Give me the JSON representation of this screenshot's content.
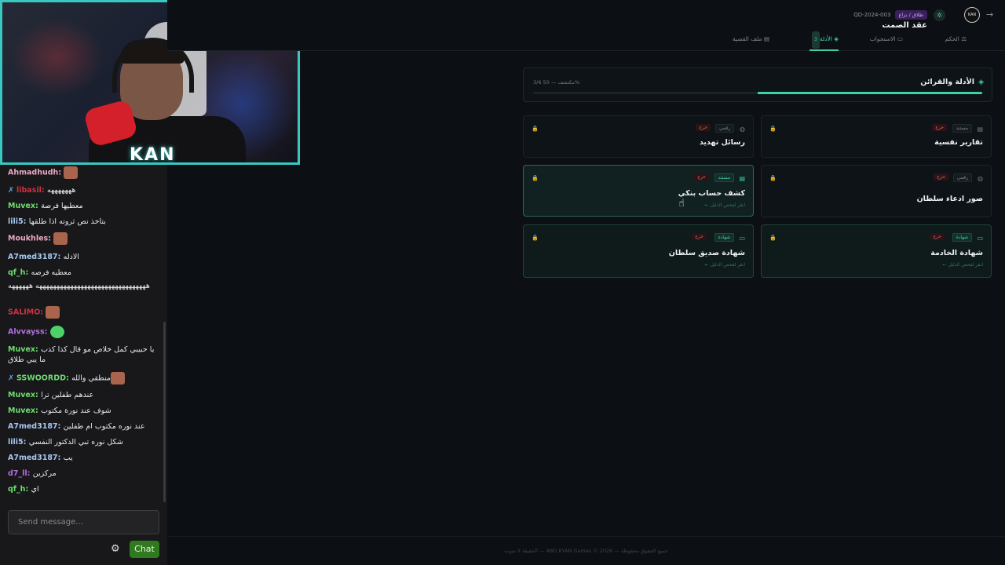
{
  "webcam": {
    "logo_text": "KAN"
  },
  "chat": {
    "messages": [
      {
        "user": "Ahmadhudh",
        "text": "",
        "emote": true,
        "color": "#e8a8c0"
      },
      {
        "user": "libasil",
        "text": "هههههههه",
        "prefix": "✗",
        "color": "#d03040"
      },
      {
        "user": "Muvex",
        "text": "معطيها فرصة",
        "color": "#6fdc6f"
      },
      {
        "user": "lili5",
        "text": "بتاخذ نص ثروته اذا طلقها",
        "color": "#a8c8f0"
      },
      {
        "user": "Moukhles",
        "text": "",
        "emote": true,
        "color": "#e8a8c0"
      },
      {
        "user": "A7med3187",
        "text": "الادله",
        "color": "#a8c8f0"
      },
      {
        "user": "qf_h",
        "text": "معطيه فرصه",
        "color": "#6fdc6f"
      },
      {
        "user": "",
        "text": "ههههههههههههههههههههههههههههههههه ههههههه",
        "color": "#fff"
      },
      {
        "user": "SALIMO",
        "text": "",
        "emote": true,
        "color": "#d03040"
      },
      {
        "user": "Alvvayss",
        "text": "",
        "emote_green": true,
        "color": "#b06fe0"
      },
      {
        "user": "Muvex",
        "text": "يا حبيبي كمل خلاص مو قال كذا كذب ما يبي طلاق",
        "color": "#6fdc6f"
      },
      {
        "user": "SSWOORDD",
        "text": "منطقي والله",
        "prefix": "✗",
        "emote": true,
        "color": "#6fdc6f"
      },
      {
        "user": "Muvex",
        "text": "عندهم طفلين ترا",
        "color": "#6fdc6f"
      },
      {
        "user": "Muvex",
        "text": "شوف عند نورة مكتوب",
        "color": "#6fdc6f"
      },
      {
        "user": "A7med3187",
        "text": "عند نوره مكتوب ام طفلين",
        "color": "#a8c8f0"
      },
      {
        "user": "lili5",
        "text": "شكل نوره تبي الدكتور النفسي",
        "color": "#a8c8f0"
      },
      {
        "user": "A7med3187",
        "text": "يب",
        "color": "#a8c8f0"
      },
      {
        "user": "d7_ll",
        "text": "مركزين",
        "color": "#b06fe0"
      },
      {
        "user": "qf_h",
        "text": "اي",
        "color": "#6fdc6f"
      }
    ],
    "input_placeholder": "Send message...",
    "chat_button": "Chat"
  },
  "header": {
    "case_id": "QD-2024-003",
    "case_badge": "طلاق / نزاع",
    "case_title": "عقد الصمت",
    "avatar_text": "KAN",
    "tabs": [
      {
        "label": "ملف القضية",
        "icon": "▤"
      },
      {
        "label": "الأدلة",
        "icon": "◈",
        "count": "3",
        "active": true
      },
      {
        "label": "الاستجواب",
        "icon": "▭"
      },
      {
        "label": "الحكم",
        "icon": "⚖"
      }
    ]
  },
  "progress": {
    "title": "الأدلة والقرائن",
    "stats": "3/6 مكتشف — 50%",
    "fraction": 0.5
  },
  "evidence": [
    {
      "title": "تقارير نفسية",
      "type": "مستند",
      "critical": "حرج",
      "unlocked": false
    },
    {
      "title": "رسائل تهديد",
      "type": "رقمي",
      "critical": "حرج",
      "unlocked": false
    },
    {
      "title": "صور ادعاء سلطان",
      "type": "رقمي",
      "critical": "حرج",
      "unlocked": false
    },
    {
      "title": "كشف حساب بنكي",
      "type": "مستند",
      "critical": "حرج",
      "unlocked": true,
      "sub": "انقر لفحص الدليل ←",
      "active": true
    },
    {
      "title": "شهادة الخادمة",
      "type": "شهادة",
      "critical": "حرج",
      "unlocked": true,
      "sub": "انقر لفحص الدليل ←"
    },
    {
      "title": "شهادة صديق سلطان",
      "type": "شهادة",
      "critical": "حرج",
      "unlocked": true,
      "sub": "انقر لفحص الدليل ←"
    }
  ],
  "footer": "جميع الحقوق محفوظة — ABO KYAN Games © 2026 — الحقيقة لا تموت"
}
